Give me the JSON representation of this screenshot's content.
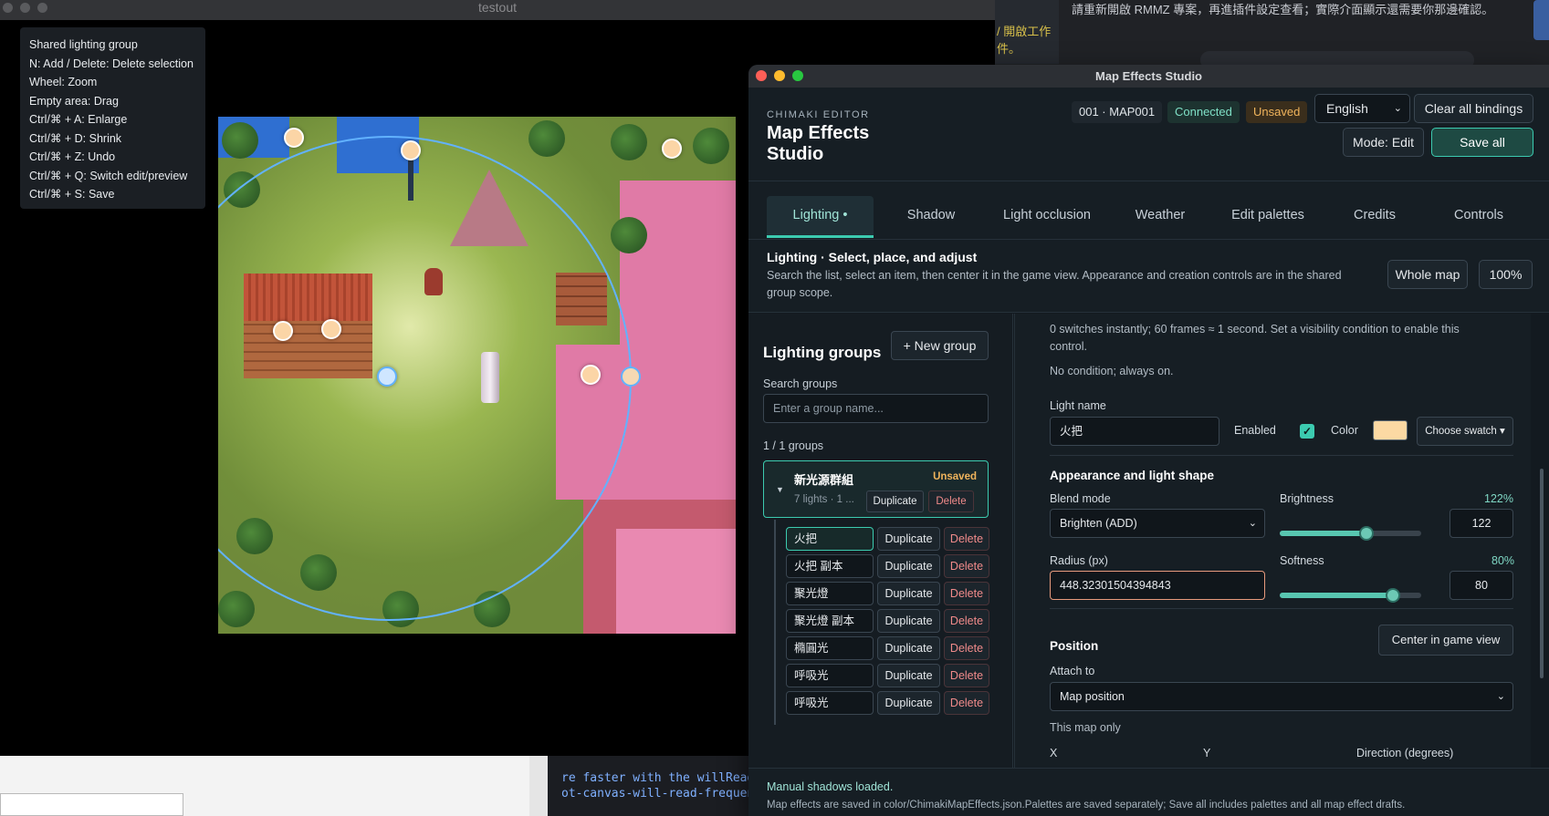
{
  "background": {
    "note_text": "請重新開啟 RMMZ 專案，再進插件設定查看；實際介面顯示還需要你那邊確認。",
    "strip_text": "/ 開啟工作 件。",
    "code_lines": [
      "re faster with the willReadFr",
      "ot-canvas-will-read-frequentl"
    ]
  },
  "testout": {
    "title": "testout",
    "shortcuts": [
      "Shared lighting group",
      "N: Add / Delete: Delete selection",
      "Wheel: Zoom",
      "Empty area: Drag",
      "Ctrl/⌘ + A: Enlarge",
      "Ctrl/⌘ + D: Shrink",
      "Ctrl/⌘ + Z: Undo",
      "Ctrl/⌘ + Q: Switch edit/preview",
      "Ctrl/⌘ + S: Save"
    ]
  },
  "studio": {
    "window_title": "Map Effects Studio",
    "brand_small": "CHIMAKI EDITOR",
    "brand_title": "Map Effects Studio",
    "map_badge": "001 · MAP001",
    "connected": "Connected",
    "unsaved": "Unsaved",
    "language": "English",
    "clear_bindings": "Clear all bindings",
    "mode": "Mode: Edit",
    "save_all": "Save all",
    "tabs": [
      "Lighting •",
      "Shadow",
      "Light occlusion",
      "Weather",
      "Edit palettes",
      "Credits",
      "Controls"
    ],
    "section_title": "Lighting · Select, place, and adjust",
    "section_desc": "Search the list, select an item, then center it in the game view. Appearance and creation controls are in the shared group scope.",
    "whole_map": "Whole map",
    "zoom": "100%",
    "colors": {
      "accent": "#3ccbb0",
      "warn": "#f0b45c",
      "danger": "#f08a8a",
      "light_color": "#fcd9a3"
    }
  },
  "groups": {
    "title": "Lighting groups",
    "new_group": "+ New group",
    "search_label": "Search groups",
    "search_placeholder": "Enter a group name...",
    "count": "1 / 1 groups",
    "group": {
      "name": "新光源群組",
      "meta": "7 lights · 1 ...",
      "status": "Unsaved",
      "duplicate": "Duplicate",
      "delete": "Delete"
    },
    "lights": [
      {
        "name": "火把",
        "duplicate": "Duplicate",
        "delete": "Delete"
      },
      {
        "name": "火把 副本",
        "duplicate": "Duplicate",
        "delete": "Delete"
      },
      {
        "name": "聚光燈",
        "duplicate": "Duplicate",
        "delete": "Delete"
      },
      {
        "name": "聚光燈 副本",
        "duplicate": "Duplicate",
        "delete": "Delete"
      },
      {
        "name": "橢圓光",
        "duplicate": "Duplicate",
        "delete": "Delete"
      },
      {
        "name": "呼吸光",
        "duplicate": "Duplicate",
        "delete": "Delete"
      },
      {
        "name": "呼吸光",
        "duplicate": "Duplicate",
        "delete": "Delete"
      }
    ]
  },
  "editor": {
    "switch_note": "0 switches instantly; 60 frames ≈ 1 second. Set a visibility condition to enable this control.",
    "condition_note": "No condition; always on.",
    "light_name_label": "Light name",
    "light_name": "火把",
    "enabled_label": "Enabled",
    "color_label": "Color",
    "choose_swatch": "Choose swatch ▾",
    "appearance_heading": "Appearance and light shape",
    "blend_label": "Blend mode",
    "blend_value": "Brighten (ADD)",
    "brightness_label": "Brightness",
    "brightness_pct": "122%",
    "brightness_value": "122",
    "brightness_fraction": 0.61,
    "radius_label": "Radius (px)",
    "radius_value": "448.32301504394843",
    "softness_label": "Softness",
    "softness_pct": "80%",
    "softness_value": "80",
    "softness_fraction": 0.8,
    "position_heading": "Position",
    "center_btn": "Center in game view",
    "attach_label": "Attach to",
    "attach_value": "Map position",
    "map_only": "This map only",
    "x_label": "X",
    "y_label": "Y",
    "direction_label": "Direction (degrees)"
  },
  "footer": {
    "status": "Manual shadows loaded.",
    "save_note": "Map effects are saved in color/ChimakiMapEffects.json.Palettes are saved separately; Save all includes palettes and all map effect drafts."
  }
}
